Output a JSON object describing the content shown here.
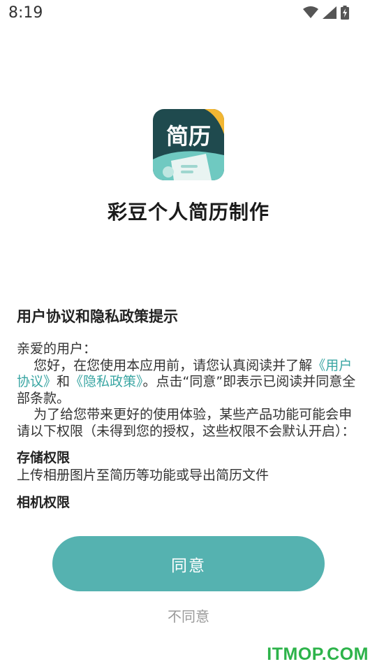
{
  "status_bar": {
    "time": "8:19",
    "icons": [
      "wifi-icon",
      "signal-icon",
      "battery-charging-icon"
    ]
  },
  "app": {
    "logo_text": "简历",
    "title": "彩豆个人简历制作",
    "accent_color": "#55b2b0",
    "logo_bg_color": "#1f4a4e",
    "logo_corner_color": "#f2b632"
  },
  "agreement": {
    "heading": "用户协议和隐私政策提示",
    "greeting": "亲爱的用户：",
    "para1_prefix": "    您好，在您使用本应用前，请您认真阅读并了解",
    "user_agreement_link": "《用户协议》",
    "and_text": "和",
    "privacy_policy_link": "《隐私政策》",
    "para1_suffix": "。点击“同意”即表示已阅读并同意全部条款。",
    "para2": "    为了给您带来更好的使用体验，某些产品功能可能会申请以下权限（未得到您的授权，这些权限不会默认开启）：",
    "permissions": [
      {
        "title": "存储权限",
        "desc": "上传相册图片至简历等功能或导出简历文件"
      },
      {
        "title": "相机权限",
        "desc": ""
      }
    ]
  },
  "actions": {
    "agree_label": "同意",
    "disagree_label": "不同意"
  },
  "watermark": "ITMOP.COM"
}
